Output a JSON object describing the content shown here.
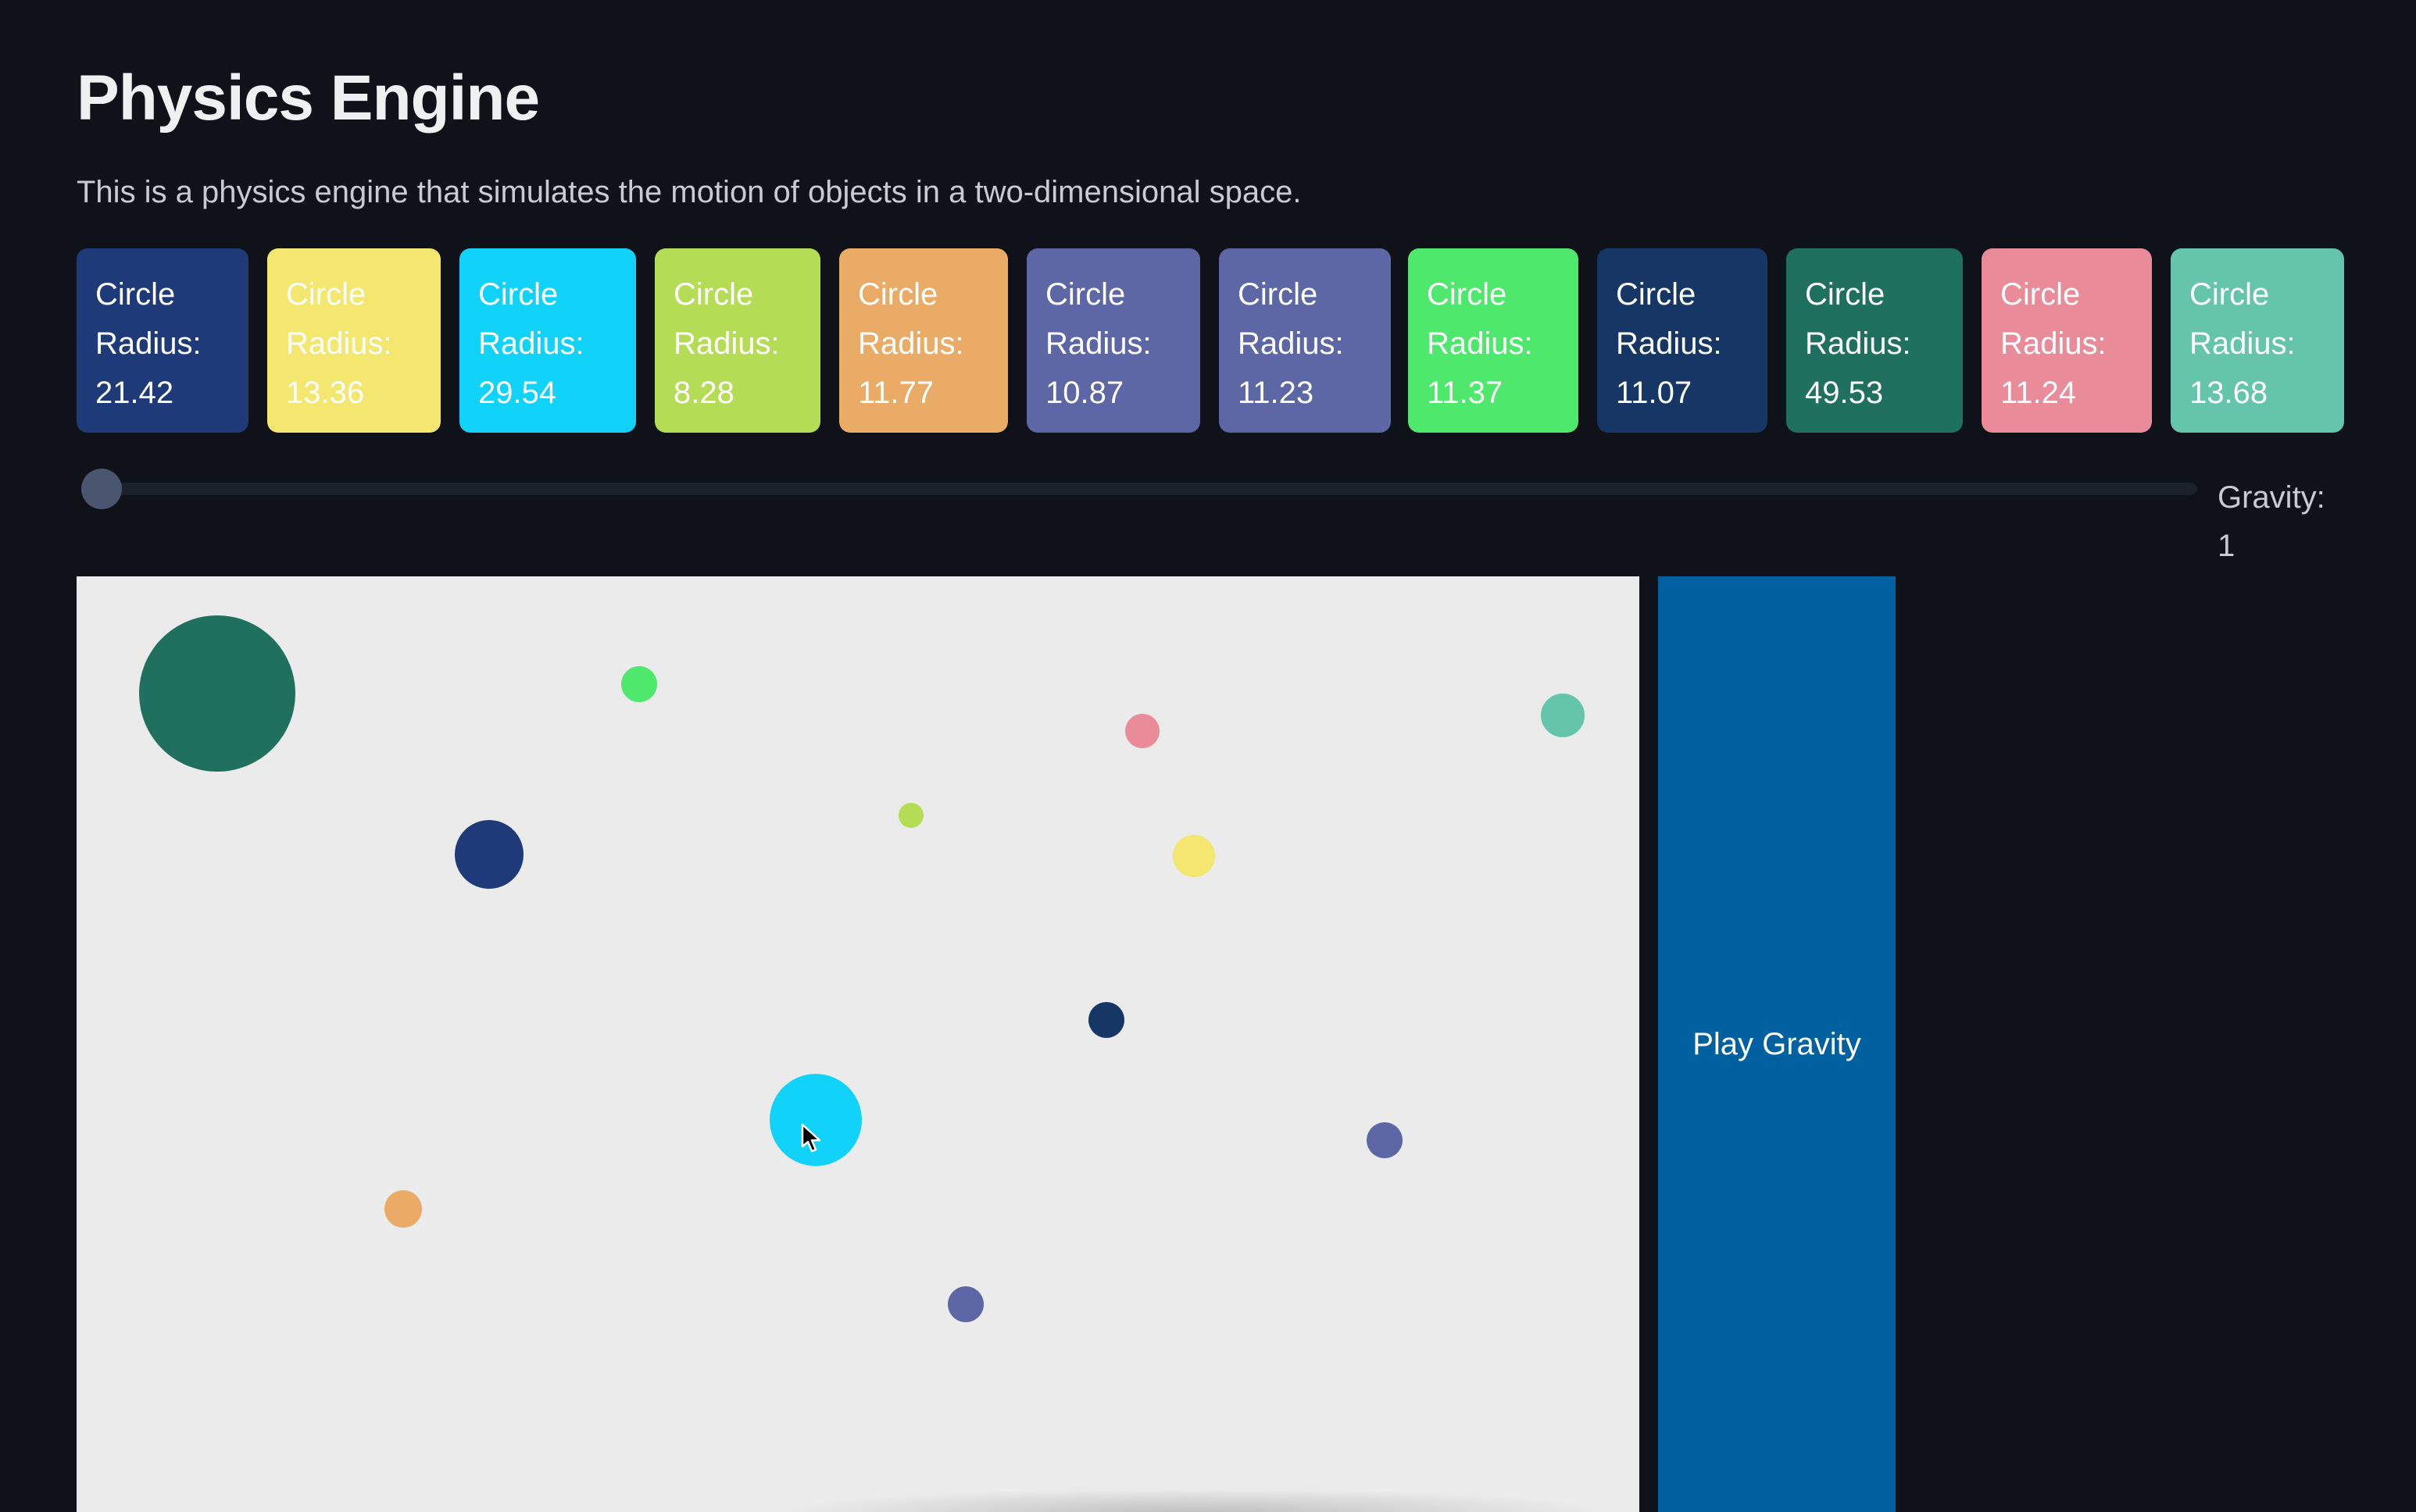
{
  "page": {
    "title": "Physics Engine",
    "description": "This is a physics engine that simulates the motion of objects in a two-dimensional space."
  },
  "cards": [
    {
      "line1": "Circle",
      "line2": "Radius:",
      "line3": "21.42",
      "color": "#1e3a78"
    },
    {
      "line1": "Circle",
      "line2": "Radius:",
      "line3": "13.36",
      "color": "#f3e76f"
    },
    {
      "line1": "Circle",
      "line2": "Radius:",
      "line3": "29.54",
      "color": "#11d3fa"
    },
    {
      "line1": "Circle",
      "line2": "Radius:",
      "line3": "8.28",
      "color": "#b5dc55"
    },
    {
      "line1": "Circle",
      "line2": "Radius:",
      "line3": "11.77",
      "color": "#e9ab65"
    },
    {
      "line1": "Circle",
      "line2": "Radius:",
      "line3": "10.87",
      "color": "#5d67a6"
    },
    {
      "line1": "Circle",
      "line2": "Radius:",
      "line3": "11.23",
      "color": "#5d67a6"
    },
    {
      "line1": "Circle",
      "line2": "Radius:",
      "line3": "11.37",
      "color": "#4ee86c"
    },
    {
      "line1": "Circle",
      "line2": "Radius:",
      "line3": "11.07",
      "color": "#163766"
    },
    {
      "line1": "Circle",
      "line2": "Radius:",
      "line3": "49.53",
      "color": "#1f705e"
    },
    {
      "line1": "Circle",
      "line2": "Radius:",
      "line3": "11.24",
      "color": "#e98b98"
    },
    {
      "line1": "Circle",
      "line2": "Radius:",
      "line3": "13.68",
      "color": "#65c5aa"
    }
  ],
  "gravity": {
    "label": "Gravity:",
    "value": "1",
    "slider_fraction": 0
  },
  "play_button": {
    "label": "Play Gravity",
    "color": "#0060a0"
  },
  "canvas": {
    "background": "#ebebeb"
  }
}
